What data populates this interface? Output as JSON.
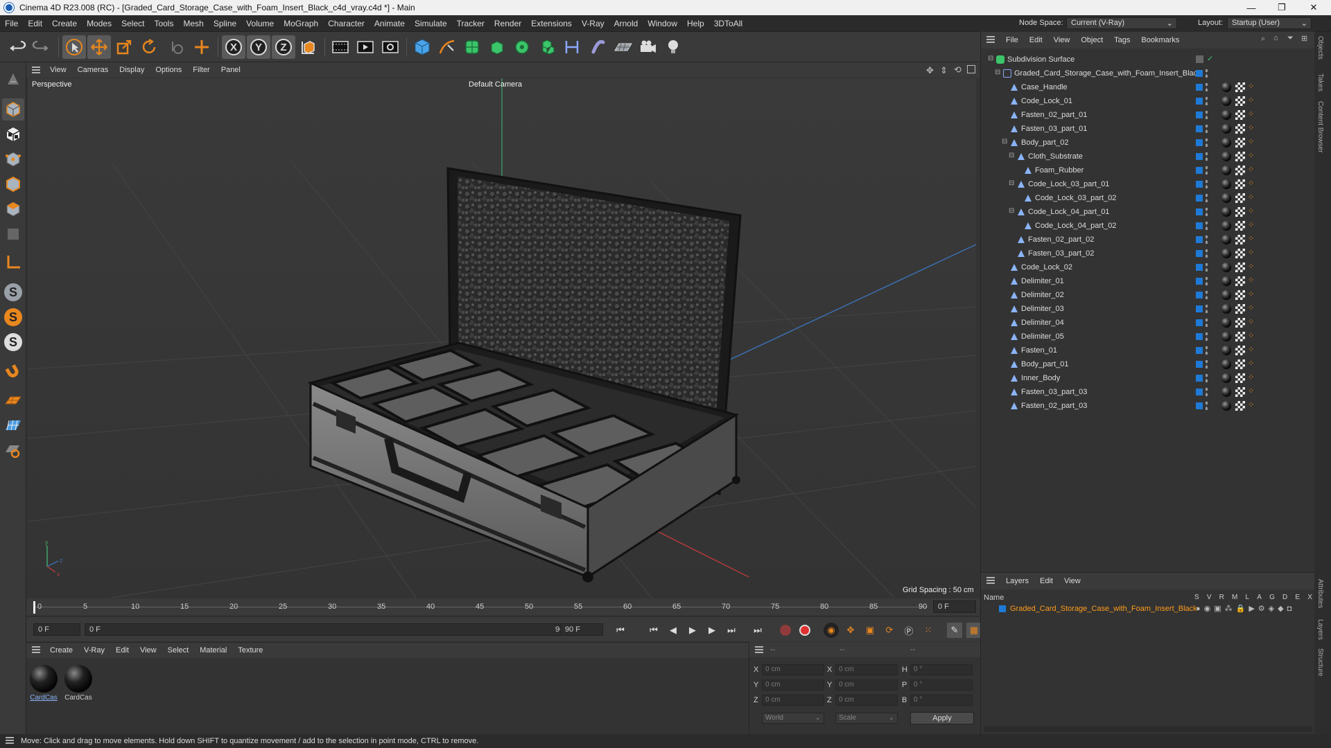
{
  "window": {
    "title": "Cinema 4D R23.008 (RC) - [Graded_Card_Storage_Case_with_Foam_Insert_Black_c4d_vray.c4d *] - Main",
    "minimize": "—",
    "maximize": "❐",
    "close": "✕"
  },
  "menubar": [
    "File",
    "Edit",
    "Create",
    "Modes",
    "Select",
    "Tools",
    "Mesh",
    "Spline",
    "Volume",
    "MoGraph",
    "Character",
    "Animate",
    "Simulate",
    "Tracker",
    "Render",
    "Extensions",
    "V-Ray",
    "Arnold",
    "Window",
    "Help",
    "3DToAll"
  ],
  "nodespace": {
    "label": "Node Space:",
    "value": "Current (V-Ray)",
    "layout_label": "Layout:",
    "layout_value": "Startup (User)"
  },
  "viewport": {
    "menu": [
      "View",
      "Cameras",
      "Display",
      "Options",
      "Filter",
      "Panel"
    ],
    "label": "Perspective",
    "camera": "Default Camera",
    "grid": "Grid Spacing : 50 cm"
  },
  "timeline": {
    "ticks": [
      "0",
      "5",
      "10",
      "15",
      "20",
      "25",
      "30",
      "35",
      "40",
      "45",
      "50",
      "55",
      "60",
      "65",
      "70",
      "75",
      "80",
      "85",
      "90"
    ],
    "frame_field": "0 F"
  },
  "transport": {
    "start": "0 F",
    "range_start": "0 F",
    "range_end": "90 F",
    "end": "90 F"
  },
  "material_panel": {
    "menu": [
      "Create",
      "V-Ray",
      "Edit",
      "View",
      "Select",
      "Material",
      "Texture"
    ],
    "materials": [
      "CardCas",
      "CardCas"
    ]
  },
  "coords": {
    "header": [
      "--",
      "--",
      "--"
    ],
    "rows": [
      {
        "a": "X",
        "av": "0 cm",
        "b": "X",
        "bv": "0 cm",
        "c": "H",
        "cv": "0 °"
      },
      {
        "a": "Y",
        "av": "0 cm",
        "b": "Y",
        "bv": "0 cm",
        "c": "P",
        "cv": "0 °"
      },
      {
        "a": "Z",
        "av": "0 cm",
        "b": "Z",
        "bv": "0 cm",
        "c": "B",
        "cv": "0 °"
      }
    ],
    "world": "World",
    "scale": "Scale",
    "apply": "Apply"
  },
  "object_manager": {
    "menu": [
      "File",
      "Edit",
      "View",
      "Object",
      "Tags",
      "Bookmarks"
    ],
    "objects": [
      {
        "name": "Subdivision Surface",
        "indent": 0,
        "type": "subd"
      },
      {
        "name": "Graded_Card_Storage_Case_with_Foam_Insert_Black",
        "indent": 1,
        "type": "null"
      },
      {
        "name": "Case_Handle",
        "indent": 2,
        "type": "poly"
      },
      {
        "name": "Code_Lock_01",
        "indent": 2,
        "type": "poly"
      },
      {
        "name": "Fasten_02_part_01",
        "indent": 2,
        "type": "poly"
      },
      {
        "name": "Fasten_03_part_01",
        "indent": 2,
        "type": "poly"
      },
      {
        "name": "Body_part_02",
        "indent": 2,
        "type": "poly"
      },
      {
        "name": "Cloth_Substrate",
        "indent": 3,
        "type": "poly"
      },
      {
        "name": "Foam_Rubber",
        "indent": 4,
        "type": "poly"
      },
      {
        "name": "Code_Lock_03_part_01",
        "indent": 3,
        "type": "poly"
      },
      {
        "name": "Code_Lock_03_part_02",
        "indent": 4,
        "type": "poly"
      },
      {
        "name": "Code_Lock_04_part_01",
        "indent": 3,
        "type": "poly"
      },
      {
        "name": "Code_Lock_04_part_02",
        "indent": 4,
        "type": "poly"
      },
      {
        "name": "Fasten_02_part_02",
        "indent": 3,
        "type": "poly"
      },
      {
        "name": "Fasten_03_part_02",
        "indent": 3,
        "type": "poly"
      },
      {
        "name": "Code_Lock_02",
        "indent": 2,
        "type": "poly"
      },
      {
        "name": "Delimiter_01",
        "indent": 2,
        "type": "poly"
      },
      {
        "name": "Delimiter_02",
        "indent": 2,
        "type": "poly"
      },
      {
        "name": "Delimiter_03",
        "indent": 2,
        "type": "poly"
      },
      {
        "name": "Delimiter_04",
        "indent": 2,
        "type": "poly"
      },
      {
        "name": "Delimiter_05",
        "indent": 2,
        "type": "poly"
      },
      {
        "name": "Fasten_01",
        "indent": 2,
        "type": "poly"
      },
      {
        "name": "Body_part_01",
        "indent": 2,
        "type": "poly"
      },
      {
        "name": "Inner_Body",
        "indent": 2,
        "type": "poly"
      },
      {
        "name": "Fasten_03_part_03",
        "indent": 2,
        "type": "poly"
      },
      {
        "name": "Fasten_02_part_03",
        "indent": 2,
        "type": "poly"
      }
    ]
  },
  "layers": {
    "menu": [
      "Layers",
      "Edit",
      "View"
    ],
    "header_name": "Name",
    "flags": [
      "S",
      "V",
      "R",
      "M",
      "L",
      "A",
      "G",
      "D",
      "E",
      "X"
    ],
    "layer_name": "Graded_Card_Storage_Case_with_Foam_Insert_Black"
  },
  "side_tabs": [
    "Objects",
    "Takes",
    "Content Browser",
    "Attributes",
    "Layers",
    "Structure"
  ],
  "status": "Move: Click and drag to move elements. Hold down SHIFT to quantize movement / add to the selection in point mode, CTRL to remove.",
  "colors": {
    "accent": "#e8871e",
    "layer": "#1e7ad6",
    "selection_orange": "#ff9c1a"
  }
}
